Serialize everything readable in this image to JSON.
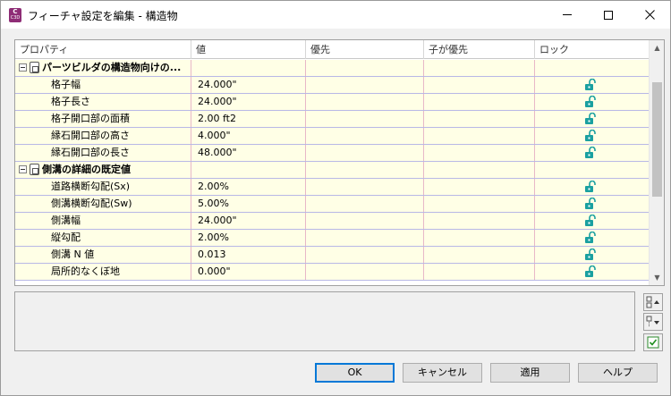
{
  "window": {
    "title": "フィーチャ設定を編集 - 構造物",
    "app_icon_letter": "C",
    "app_icon_sub": "C3D"
  },
  "grid": {
    "columns": [
      "プロパティ",
      "値",
      "優先",
      "子が優先",
      "ロック"
    ],
    "groups": [
      {
        "label": "パーツビルダの構造物向けの...",
        "rows": [
          {
            "property": "格子幅",
            "value": "24.000\""
          },
          {
            "property": "格子長さ",
            "value": "24.000\""
          },
          {
            "property": "格子開口部の面積",
            "value": "2.00 ft2"
          },
          {
            "property": "縁石開口部の高さ",
            "value": "4.000\""
          },
          {
            "property": "縁石開口部の長さ",
            "value": "48.000\""
          }
        ]
      },
      {
        "label": "側溝の詳細の既定値",
        "rows": [
          {
            "property": "道路横断勾配(Sx)",
            "value": "2.00%"
          },
          {
            "property": "側溝横断勾配(Sw)",
            "value": "5.00%"
          },
          {
            "property": "側溝幅",
            "value": "24.000\""
          },
          {
            "property": "縦勾配",
            "value": "2.00%"
          },
          {
            "property": "側溝 N 値",
            "value": "0.013"
          },
          {
            "property": "局所的なくぼ地",
            "value": "0.000\""
          }
        ]
      }
    ]
  },
  "buttons": {
    "ok": "OK",
    "cancel": "キャンセル",
    "apply": "適用",
    "help": "ヘルプ"
  },
  "colors": {
    "row_background": "#ffffe6",
    "lock_icon": "#1aa0a0",
    "app_icon": "#8e2d76",
    "default_button_border": "#0078d7"
  }
}
